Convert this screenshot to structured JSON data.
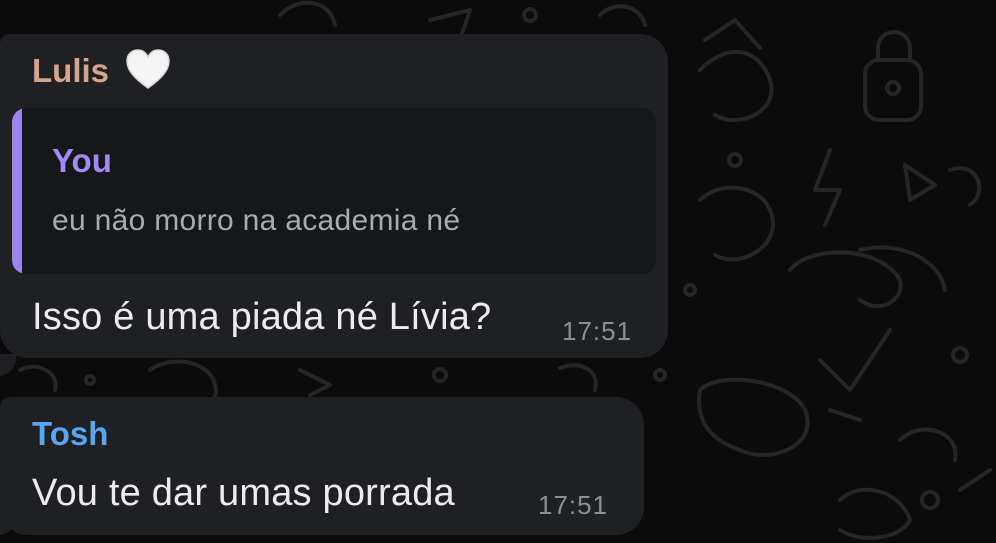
{
  "colors": {
    "background": "#0b0b0b",
    "bubble": "#1f2023",
    "quote_background": "#161718",
    "quote_accent": "#9b84ec",
    "sender_lulis": "#d4a58b",
    "sender_tosh": "#5aa5f2",
    "quote_author": "#a389f4",
    "message_text": "#ececec",
    "timestamp": "#8d8f93"
  },
  "messages": [
    {
      "sender": "Lulis",
      "sender_icon": "white-heart-emoji",
      "reply": {
        "author": "You",
        "text": "eu não morro na academia né"
      },
      "text": "Isso é uma piada né Lívia?",
      "time": "17:51"
    },
    {
      "sender": "Tosh",
      "text": "Vou te dar umas porrada",
      "time": "17:51"
    }
  ]
}
